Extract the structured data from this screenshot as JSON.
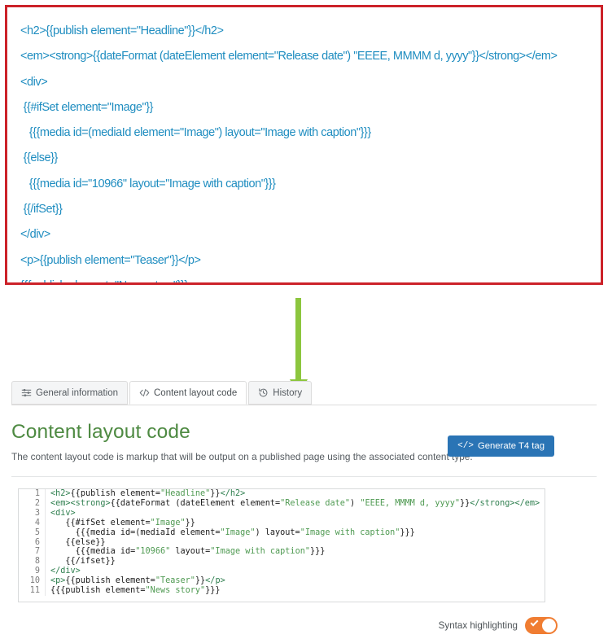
{
  "callout": {
    "border_color": "#cc2229",
    "text_color": "#1f8dc0",
    "lines": [
      "<h2>{{publish element=\"Headline\"}}</h2>",
      "<em><strong>{{dateFormat (dateElement element=\"Release date\") \"EEEE, MMMM d, yyyy\"}}</strong></em>",
      "<div>",
      " {{#ifSet element=\"Image\"}}",
      "   {{{media id=(mediaId element=\"Image\") layout=\"Image with caption\"}}}",
      " {{else}}",
      "   {{{media id=\"10966\" layout=\"Image with caption\"}}}",
      " {{/ifSet}}",
      "</div>",
      "<p>{{publish element=\"Teaser\"}}</p>",
      "{{{publish element=\"News story\"}}}"
    ]
  },
  "arrow": {
    "color": "#8cc63e",
    "direction": "down"
  },
  "tabs": [
    {
      "label": "General information",
      "icon": "sliders-icon",
      "active": false
    },
    {
      "label": "Content layout code",
      "icon": "code-icon",
      "active": true
    },
    {
      "label": "History",
      "icon": "history-icon",
      "active": false
    }
  ],
  "section": {
    "title": "Content layout code",
    "title_color": "#4e8a42",
    "description": "The content layout code is markup that will be output on a published page using the associated content type.",
    "generate_button": {
      "label": "Generate T4 tag",
      "icon": "code-icon",
      "color": "#2a74b5"
    }
  },
  "editor": {
    "lines": [
      {
        "n": "1",
        "tokens": [
          {
            "t": "tag",
            "v": "<h2>"
          },
          {
            "t": "plain",
            "v": "{{publish element="
          },
          {
            "t": "str",
            "v": "\"Headline\""
          },
          {
            "t": "plain",
            "v": "}}"
          },
          {
            "t": "tag",
            "v": "</h2>"
          }
        ]
      },
      {
        "n": "2",
        "tokens": [
          {
            "t": "tag",
            "v": "<em><strong>"
          },
          {
            "t": "plain",
            "v": "{{dateFormat (dateElement element="
          },
          {
            "t": "str",
            "v": "\"Release date\""
          },
          {
            "t": "plain",
            "v": ") "
          },
          {
            "t": "str",
            "v": "\"EEEE, MMMM d, yyyy\""
          },
          {
            "t": "plain",
            "v": "}}"
          },
          {
            "t": "tag",
            "v": "</strong></em>"
          }
        ]
      },
      {
        "n": "3",
        "tokens": [
          {
            "t": "tag",
            "v": "<div>"
          }
        ]
      },
      {
        "n": "4",
        "tokens": [
          {
            "t": "plain",
            "v": "   {{#ifSet element="
          },
          {
            "t": "str",
            "v": "\"Image\""
          },
          {
            "t": "plain",
            "v": "}}"
          }
        ]
      },
      {
        "n": "5",
        "tokens": [
          {
            "t": "plain",
            "v": "     {{{media id=(mediaId element="
          },
          {
            "t": "str",
            "v": "\"Image\""
          },
          {
            "t": "plain",
            "v": ") layout="
          },
          {
            "t": "str",
            "v": "\"Image with caption\""
          },
          {
            "t": "plain",
            "v": "}}}"
          }
        ]
      },
      {
        "n": "6",
        "tokens": [
          {
            "t": "plain",
            "v": "   {{else}}"
          }
        ]
      },
      {
        "n": "7",
        "tokens": [
          {
            "t": "plain",
            "v": "     {{{media id="
          },
          {
            "t": "str",
            "v": "\"10966\""
          },
          {
            "t": "plain",
            "v": " layout="
          },
          {
            "t": "str",
            "v": "\"Image with caption\""
          },
          {
            "t": "plain",
            "v": "}}}"
          }
        ]
      },
      {
        "n": "8",
        "tokens": [
          {
            "t": "plain",
            "v": "   {{/ifset}}"
          }
        ]
      },
      {
        "n": "9",
        "tokens": [
          {
            "t": "tag",
            "v": "</div>"
          }
        ]
      },
      {
        "n": "10",
        "tokens": [
          {
            "t": "tag",
            "v": "<p>"
          },
          {
            "t": "plain",
            "v": "{{publish element="
          },
          {
            "t": "str",
            "v": "\"Teaser\""
          },
          {
            "t": "plain",
            "v": "}}"
          },
          {
            "t": "tag",
            "v": "</p>"
          }
        ]
      },
      {
        "n": "11",
        "tokens": [
          {
            "t": "plain",
            "v": "{{{publish element="
          },
          {
            "t": "str",
            "v": "\"News story\""
          },
          {
            "t": "plain",
            "v": "}}}"
          }
        ]
      }
    ]
  },
  "syntax_toggle": {
    "label": "Syntax highlighting",
    "state": "on",
    "color": "#f07d32"
  }
}
